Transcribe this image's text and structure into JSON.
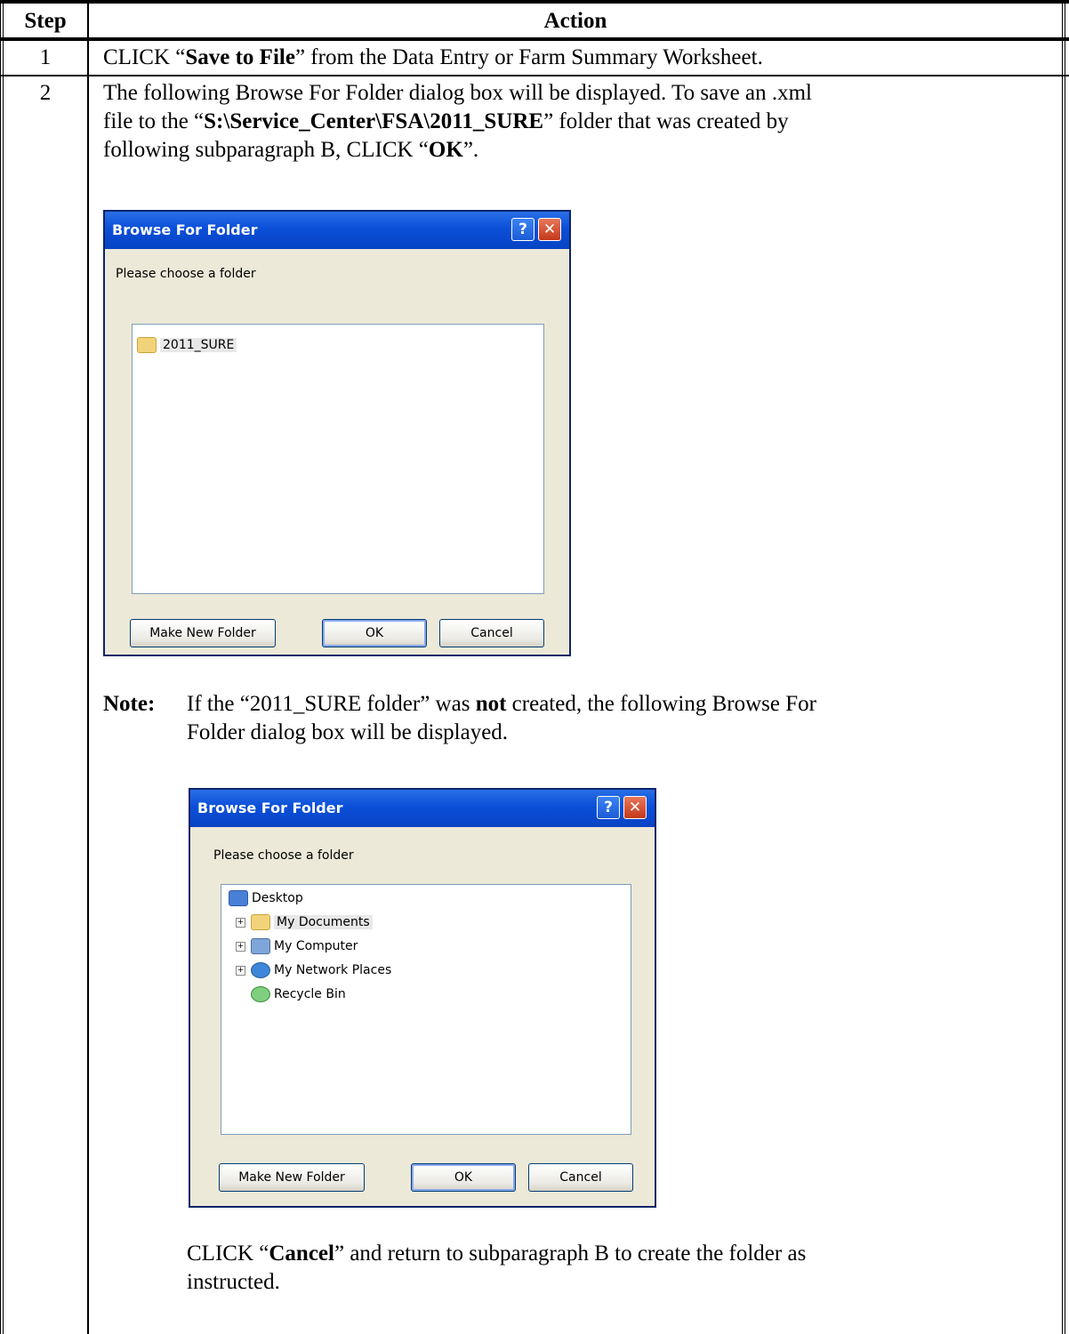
{
  "table": {
    "header": {
      "step": "Step",
      "action": "Action"
    },
    "rows": [
      {
        "step": "1",
        "text": {
          "pre": "CLICK “",
          "bold": "Save to File",
          "post": "” from the Data Entry or Farm Summary Worksheet."
        }
      },
      {
        "step": "2",
        "line1": "The following Browse For Folder dialog box will be displayed.  To save an .xml",
        "line2": {
          "pre": "file to the “",
          "bold": "S:\\Service_Center\\FSA\\2011_SURE",
          "post": "” folder that was created by"
        },
        "line3": {
          "pre": "following subparagraph B, CLICK “",
          "bold": "OK",
          "post": "”."
        },
        "note": {
          "label": "Note:",
          "pre": "If the “2011_SURE folder” was ",
          "bold": "not",
          "post": " created, the following Browse For",
          "line2": "Folder dialog box will be displayed."
        },
        "final": {
          "pre": "CLICK “",
          "bold": "Cancel",
          "post": "” and return to subparagraph B to create the folder as",
          "line2": "instructed."
        }
      }
    ]
  },
  "dialog1": {
    "title": "Browse For Folder",
    "help": "?",
    "close": "✕",
    "prompt": "Please choose a folder",
    "items": [
      "2011_SURE"
    ],
    "buttons": {
      "new": "Make New Folder",
      "ok": "OK",
      "cancel": "Cancel"
    }
  },
  "dialog2": {
    "title": "Browse For Folder",
    "help": "?",
    "close": "✕",
    "prompt": "Please choose a folder",
    "items": [
      "Desktop",
      "My Documents",
      "My Computer",
      "My Network Places",
      "Recycle Bin"
    ],
    "buttons": {
      "new": "Make New Folder",
      "ok": "OK",
      "cancel": "Cancel"
    }
  }
}
